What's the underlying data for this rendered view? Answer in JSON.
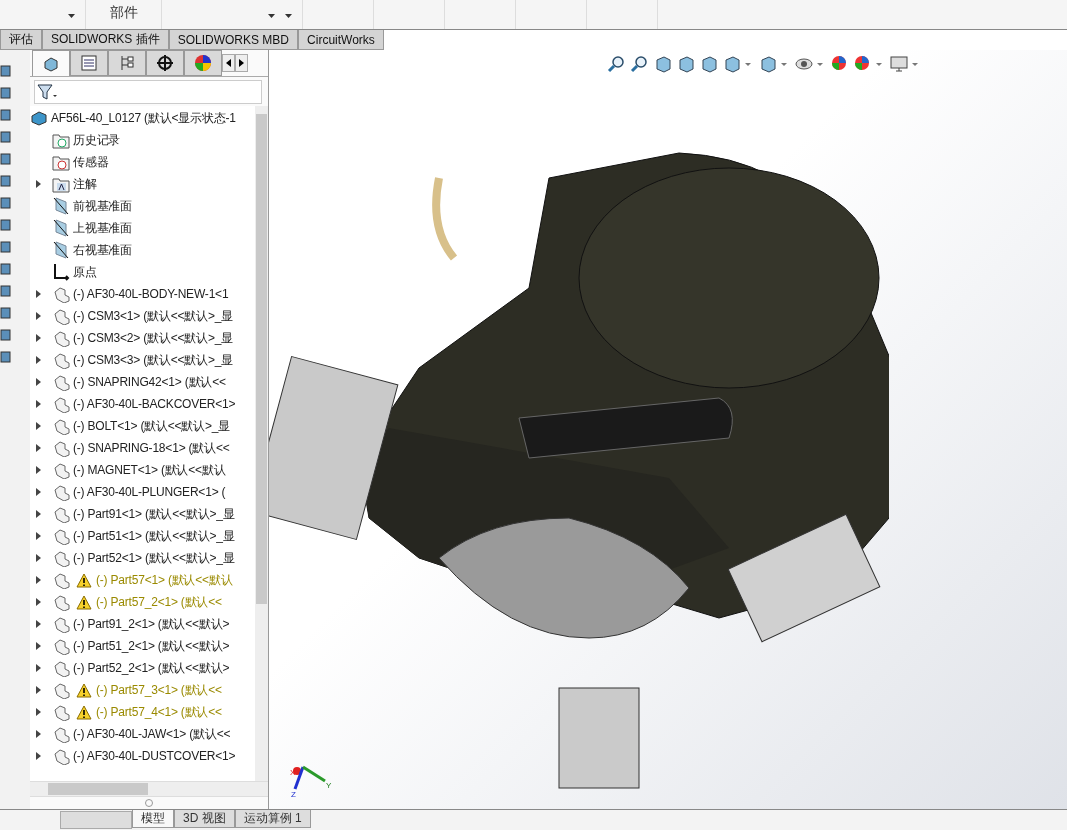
{
  "ribbon": {
    "label": "部件"
  },
  "command_tabs": [
    {
      "label": "评估",
      "selected": false
    },
    {
      "label": "SOLIDWORKS 插件",
      "selected": false
    },
    {
      "label": "SOLIDWORKS MBD",
      "selected": false
    },
    {
      "label": "CircuitWorks",
      "selected": false
    }
  ],
  "panel_tabs": [
    {
      "kind": "feature",
      "selected": true
    },
    {
      "kind": "property",
      "selected": false
    },
    {
      "kind": "config",
      "selected": false
    },
    {
      "kind": "dimxpert",
      "selected": false
    },
    {
      "kind": "display",
      "selected": false
    }
  ],
  "tree": [
    {
      "kind": "root",
      "label": "AF56L-40_L0127  (默认<显示状态-1",
      "expandable": false,
      "warning": false
    },
    {
      "kind": "history",
      "label": "历史记录",
      "expandable": false,
      "warning": false
    },
    {
      "kind": "sensor",
      "label": "传感器",
      "expandable": false,
      "warning": false
    },
    {
      "kind": "annotation",
      "label": "注解",
      "expandable": true,
      "warning": false
    },
    {
      "kind": "plane",
      "label": "前视基准面",
      "expandable": false,
      "warning": false
    },
    {
      "kind": "plane",
      "label": "上视基准面",
      "expandable": false,
      "warning": false
    },
    {
      "kind": "plane",
      "label": "右视基准面",
      "expandable": false,
      "warning": false
    },
    {
      "kind": "origin",
      "label": "原点",
      "expandable": false,
      "warning": false
    },
    {
      "kind": "part",
      "label": "(-) AF30-40L-BODY-NEW-1<1",
      "expandable": true,
      "warning": false
    },
    {
      "kind": "part",
      "label": "(-) CSM3<1> (默认<<默认>_显",
      "expandable": true,
      "warning": false
    },
    {
      "kind": "part",
      "label": "(-) CSM3<2> (默认<<默认>_显",
      "expandable": true,
      "warning": false
    },
    {
      "kind": "part",
      "label": "(-) CSM3<3> (默认<<默认>_显",
      "expandable": true,
      "warning": false
    },
    {
      "kind": "part",
      "label": "(-) SNAPRING42<1> (默认<<",
      "expandable": true,
      "warning": false
    },
    {
      "kind": "part",
      "label": "(-) AF30-40L-BACKCOVER<1>",
      "expandable": true,
      "warning": false
    },
    {
      "kind": "part",
      "label": "(-) BOLT<1> (默认<<默认>_显",
      "expandable": true,
      "warning": false
    },
    {
      "kind": "part",
      "label": "(-) SNAPRING-18<1> (默认<<",
      "expandable": true,
      "warning": false
    },
    {
      "kind": "part",
      "label": "(-) MAGNET<1> (默认<<默认",
      "expandable": true,
      "warning": false
    },
    {
      "kind": "part",
      "label": "(-) AF30-40L-PLUNGER<1> (",
      "expandable": true,
      "warning": false
    },
    {
      "kind": "part",
      "label": "(-) Part91<1> (默认<<默认>_显",
      "expandable": true,
      "warning": false
    },
    {
      "kind": "part",
      "label": "(-) Part51<1> (默认<<默认>_显",
      "expandable": true,
      "warning": false
    },
    {
      "kind": "part",
      "label": "(-) Part52<1> (默认<<默认>_显",
      "expandable": true,
      "warning": false
    },
    {
      "kind": "part",
      "label": "(-) Part57<1> (默认<<默认",
      "expandable": true,
      "warning": true
    },
    {
      "kind": "part",
      "label": "(-) Part57_2<1> (默认<<",
      "expandable": true,
      "warning": true
    },
    {
      "kind": "part",
      "label": "(-) Part91_2<1> (默认<<默认>",
      "expandable": true,
      "warning": false
    },
    {
      "kind": "part",
      "label": "(-) Part51_2<1> (默认<<默认>",
      "expandable": true,
      "warning": false
    },
    {
      "kind": "part",
      "label": "(-) Part52_2<1> (默认<<默认>",
      "expandable": true,
      "warning": false
    },
    {
      "kind": "part",
      "label": "(-) Part57_3<1> (默认<<",
      "expandable": true,
      "warning": true
    },
    {
      "kind": "part",
      "label": "(-) Part57_4<1> (默认<<",
      "expandable": true,
      "warning": true
    },
    {
      "kind": "part",
      "label": "(-) AF30-40L-JAW<1> (默认<<",
      "expandable": true,
      "warning": false
    },
    {
      "kind": "part",
      "label": "(-) AF30-40L-DUSTCOVER<1>",
      "expandable": true,
      "warning": false
    }
  ],
  "triad": {
    "x_label": "X",
    "y_label": "Y",
    "z_label": "Z"
  },
  "bottom_tabs": [
    {
      "label": "模型",
      "selected": true
    },
    {
      "label": "3D 视图",
      "selected": false
    },
    {
      "label": "运动算例 1",
      "selected": false
    }
  ]
}
